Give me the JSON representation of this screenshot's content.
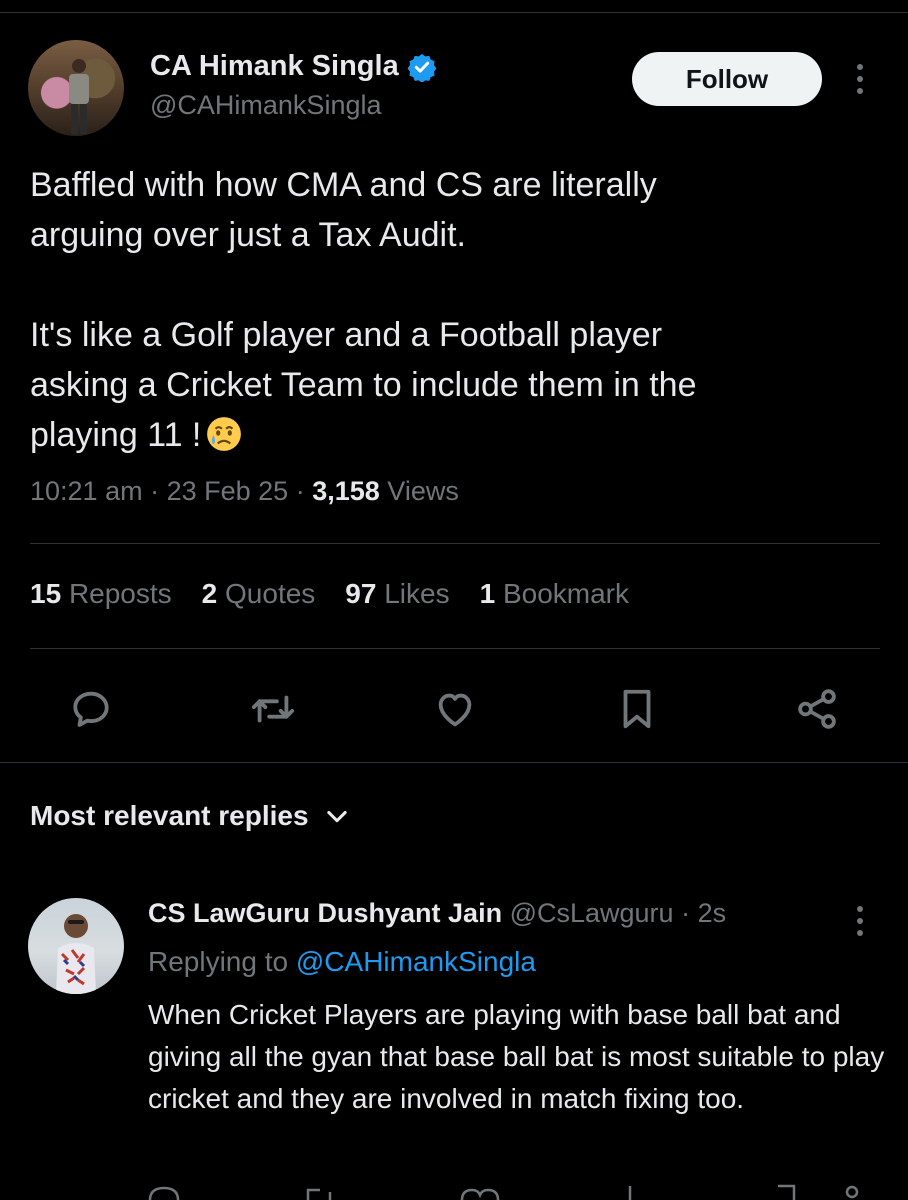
{
  "tweet": {
    "author_name": "CA Himank Singla",
    "author_handle": "@CAHimankSingla",
    "follow_label": "Follow",
    "text": "Baffled with how CMA and CS are literally\narguing over just a Tax Audit.\n\nIt's like a Golf player and a Football player\nasking a Cricket Team to include them in the\nplaying 11 !",
    "emoji": "crying-face-icon",
    "time": "10:21 am",
    "date": "23 Feb 25",
    "views_count": "3,158",
    "views_label": "Views"
  },
  "stats": {
    "reposts_count": "15",
    "reposts_label": "Reposts",
    "quotes_count": "2",
    "quotes_label": "Quotes",
    "likes_count": "97",
    "likes_label": "Likes",
    "bookmarks_count": "1",
    "bookmarks_label": "Bookmark"
  },
  "actions": [
    "reply-icon",
    "repost-icon",
    "like-icon",
    "bookmark-icon",
    "share-icon"
  ],
  "replies": {
    "sort_label": "Most relevant replies",
    "items": [
      {
        "author_name": "CS LawGuru Dushyant Jain",
        "author_handle": "@CsLawguru",
        "time_ago": "2s",
        "replying_to_label": "Replying to",
        "replying_to_handle": "@CAHimankSingla",
        "text": "When Cricket Players are playing with base ball bat and giving all the gyan that base ball bat is most suitable to play cricket and  they are involved in match fixing too."
      }
    ]
  },
  "colors": {
    "background": "#000000",
    "text_primary": "#e7e9ea",
    "text_secondary": "#71767b",
    "accent": "#1d9bf0",
    "divider": "#2f3336"
  }
}
